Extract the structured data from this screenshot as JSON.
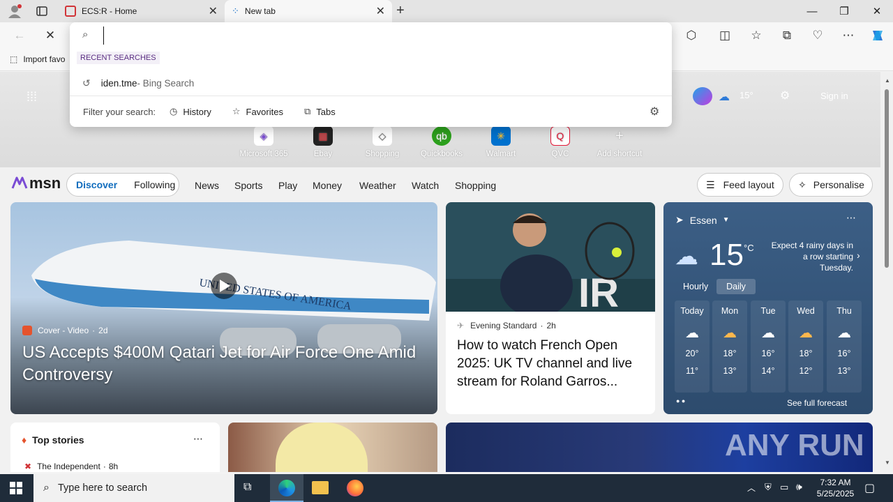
{
  "tabs": [
    {
      "title": "ECS:R - Home",
      "active": false
    },
    {
      "title": "New tab",
      "active": true
    }
  ],
  "window_controls": {
    "minimize": "—",
    "restore": "❐",
    "close": "✕"
  },
  "favorites_bar": {
    "import_label": "Import favo"
  },
  "search_dropdown": {
    "input_value": "",
    "recent_header": "RECENT SEARCHES",
    "recent_items": [
      {
        "query": "iden.tme",
        "source": " - Bing Search"
      }
    ],
    "filter_label": "Filter your search:",
    "filters": [
      "History",
      "Favorites",
      "Tabs"
    ]
  },
  "hero_overlay": {
    "weather_temp": "15°",
    "sign_in": "Sign in"
  },
  "shortcuts": [
    {
      "label": "Microsoft 365",
      "icon": "microsoft365-icon",
      "color": "#7b4bd6"
    },
    {
      "label": "Ebay",
      "icon": "ebay-icon",
      "color": "#e53238"
    },
    {
      "label": "Shopping",
      "icon": "tag-icon",
      "color": "#555555"
    },
    {
      "label": "Quickbooks",
      "icon": "quickbooks-icon",
      "color": "#2ca01c"
    },
    {
      "label": "Walmart",
      "icon": "walmart-icon",
      "color": "#0071ce"
    },
    {
      "label": "QVC",
      "icon": "qvc-icon",
      "color": "#e31837"
    },
    {
      "label": "Add shortcut",
      "icon": "plus-icon",
      "color": "#555555"
    }
  ],
  "msn": {
    "logo": "msn",
    "tabs": [
      "Discover",
      "Following"
    ],
    "nav": [
      "News",
      "Sports",
      "Play",
      "Money",
      "Weather",
      "Watch",
      "Shopping"
    ],
    "feed_layout": "Feed layout",
    "personalise": "Personalise"
  },
  "hero_story": {
    "source": "Cover - Video",
    "age": "2d",
    "headline": "US Accepts $400M Qatari Jet for Air Force One Amid Controversy",
    "plane_text": "UNITED STATES OF AMERICA"
  },
  "tennis_story": {
    "source": "Evening Standard",
    "age": "2h",
    "headline": "How to watch French Open 2025: UK TV channel and live stream for Roland Garros..."
  },
  "weather": {
    "location": "Essen",
    "temp": "15",
    "unit": "°C",
    "summary": "Expect 4 rainy days in a row starting Tuesday.",
    "toggle": [
      "Hourly",
      "Daily"
    ],
    "days": [
      {
        "day": "Today",
        "high": "20°",
        "low": "11°"
      },
      {
        "day": "Mon",
        "high": "18°",
        "low": "13°"
      },
      {
        "day": "Tue",
        "high": "16°",
        "low": "14°"
      },
      {
        "day": "Wed",
        "high": "18°",
        "low": "12°"
      },
      {
        "day": "Thu",
        "high": "16°",
        "low": "13°"
      }
    ],
    "see_full": "See full forecast"
  },
  "top_stories": {
    "title": "Top stories",
    "first_source": "The Independent",
    "first_age": "8h"
  },
  "watermark": "ANY RUN",
  "taskbar": {
    "search_placeholder": "Type here to search",
    "time": "7:32 AM",
    "date": "5/25/2025"
  }
}
